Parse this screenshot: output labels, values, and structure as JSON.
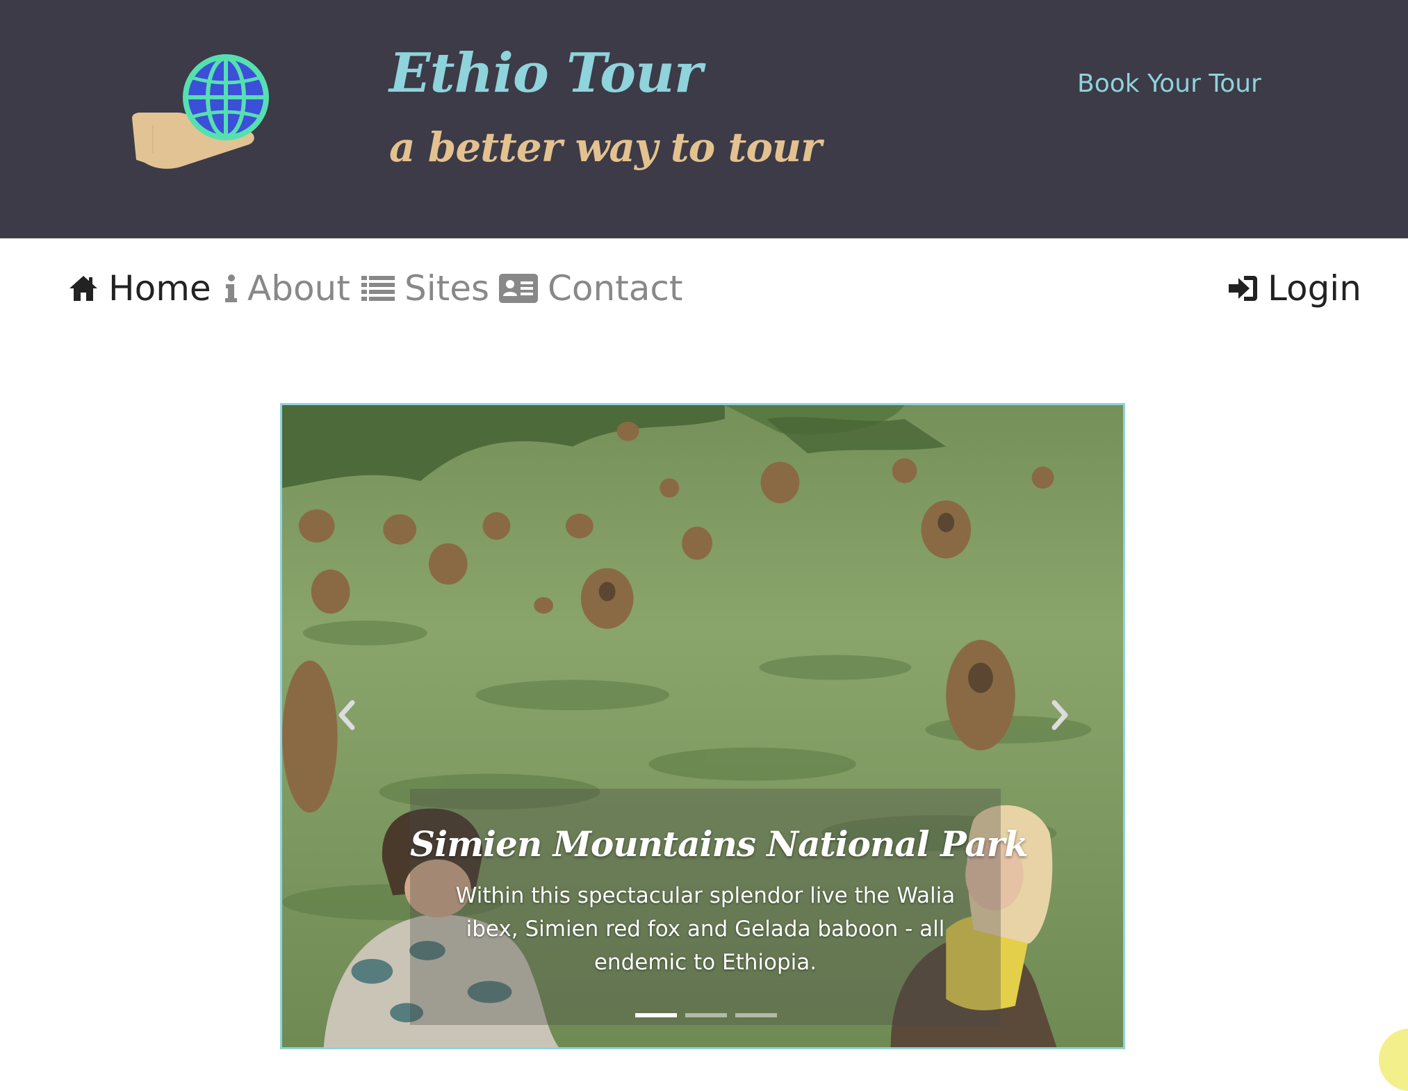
{
  "header": {
    "brand_title": "Ethio Tour",
    "brand_tagline": "a better way to tour",
    "book_link": "Book Your Tour",
    "logo_icon": "globe-in-hand-icon",
    "colors": {
      "background": "#3c3b47",
      "title": "#8fd3dc",
      "tagline": "#e4c28f"
    }
  },
  "nav": {
    "items": [
      {
        "label": "Home",
        "icon": "home-icon",
        "active": true
      },
      {
        "label": "About",
        "icon": "info-icon",
        "active": false
      },
      {
        "label": "Sites",
        "icon": "list-icon",
        "active": false
      },
      {
        "label": "Contact",
        "icon": "contact-card-icon",
        "active": false
      }
    ],
    "login": {
      "label": "Login",
      "icon": "sign-in-icon"
    }
  },
  "carousel": {
    "caption_title": "Simien Mountains National Park",
    "caption_text": "Within this spectacular splendor live the Walia ibex, Simien red fox and Gelada baboon - all endemic to Ethiopia.",
    "slide_count": 3,
    "active_slide": 1,
    "border_color": "#8fd3dc"
  }
}
